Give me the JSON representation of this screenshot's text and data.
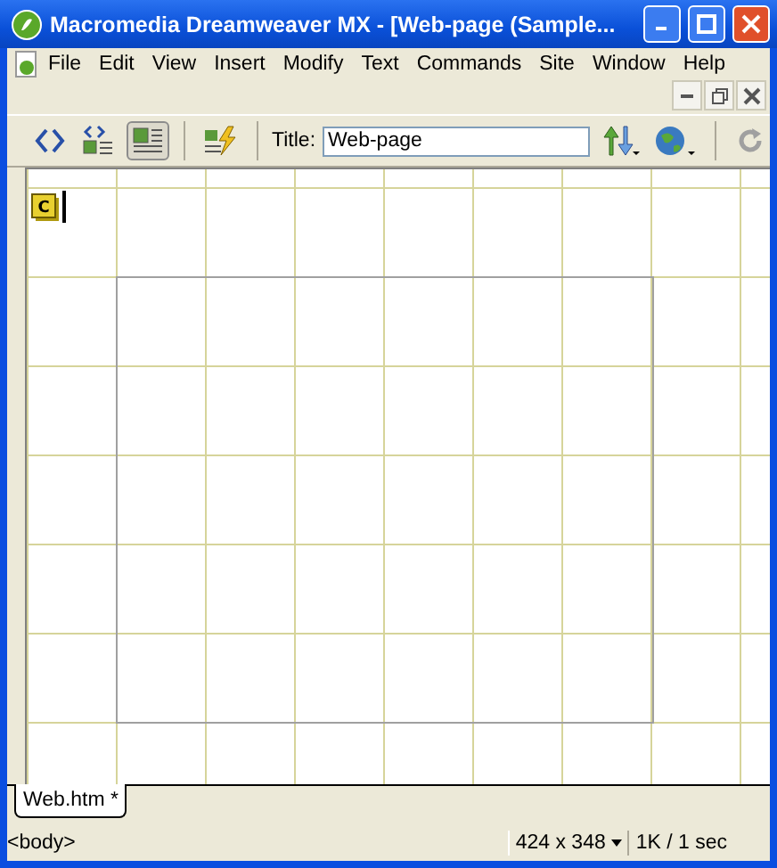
{
  "window": {
    "title": "Macromedia Dreamweaver MX - [Web-page (Sample..."
  },
  "menu": [
    "File",
    "Edit",
    "View",
    "Insert",
    "Modify",
    "Text",
    "Commands",
    "Site",
    "Window",
    "Help"
  ],
  "toolbar": {
    "views": [
      {
        "kind": "code",
        "selected": false
      },
      {
        "kind": "split",
        "selected": false
      },
      {
        "kind": "design",
        "selected": true
      }
    ],
    "title_label": "Title:",
    "title_value": "Web-page"
  },
  "document": {
    "marker": "C"
  },
  "tabs": [
    {
      "label": "Web.htm *",
      "selected": true
    }
  ],
  "status_bar": {
    "tag": "<body>",
    "size": "424 x 348",
    "download": "1K / 1 sec"
  }
}
